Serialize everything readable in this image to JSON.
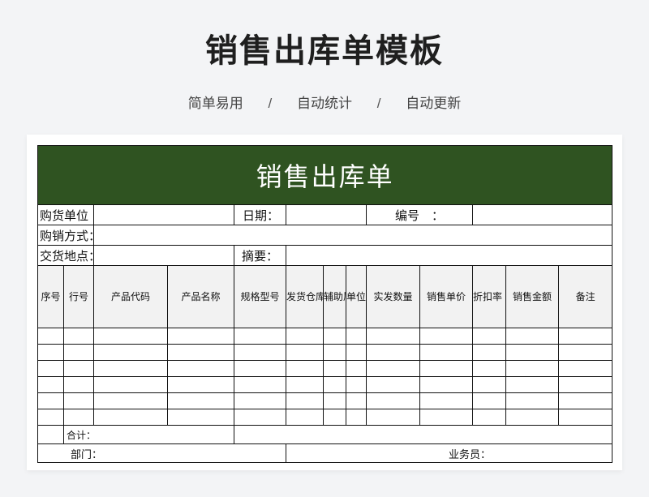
{
  "title": "销售出库单模板",
  "tagline": {
    "items": [
      "简单易用",
      "自动统计",
      "自动更新"
    ],
    "separator": "/"
  },
  "form": {
    "banner": "销售出库单",
    "fields": {
      "buyer": "购货单位",
      "date": "日期：",
      "number": "编号　：",
      "sales_method": "购销方式：",
      "delivery": "交货地点：",
      "summary": "摘要："
    },
    "columns": [
      "序号",
      "行号",
      "产品代码",
      "产品名称",
      "规格型号",
      "发货仓库",
      "辅助属性",
      "单位",
      "实发数量",
      "销售单价",
      "折扣率（%）",
      "销售金额",
      "备注"
    ],
    "blank_rows": 6,
    "total_label": "合计：",
    "footer": {
      "department": "部门：",
      "salesperson": "业务员："
    }
  },
  "colors": {
    "banner_bg": "#2f5321",
    "banner_text": "#ffffff",
    "header_bg": "#f2f2f2",
    "page_bg": "#f3f4f6"
  }
}
